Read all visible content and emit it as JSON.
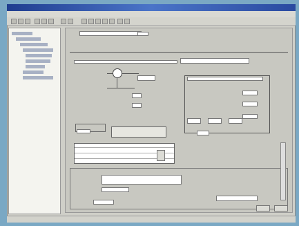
{
  "titlebar": {
    "title": ""
  },
  "menu": [
    "",
    "",
    "",
    "",
    ""
  ],
  "main": {
    "header": ""
  },
  "status": {
    "left": "",
    "right": ""
  }
}
